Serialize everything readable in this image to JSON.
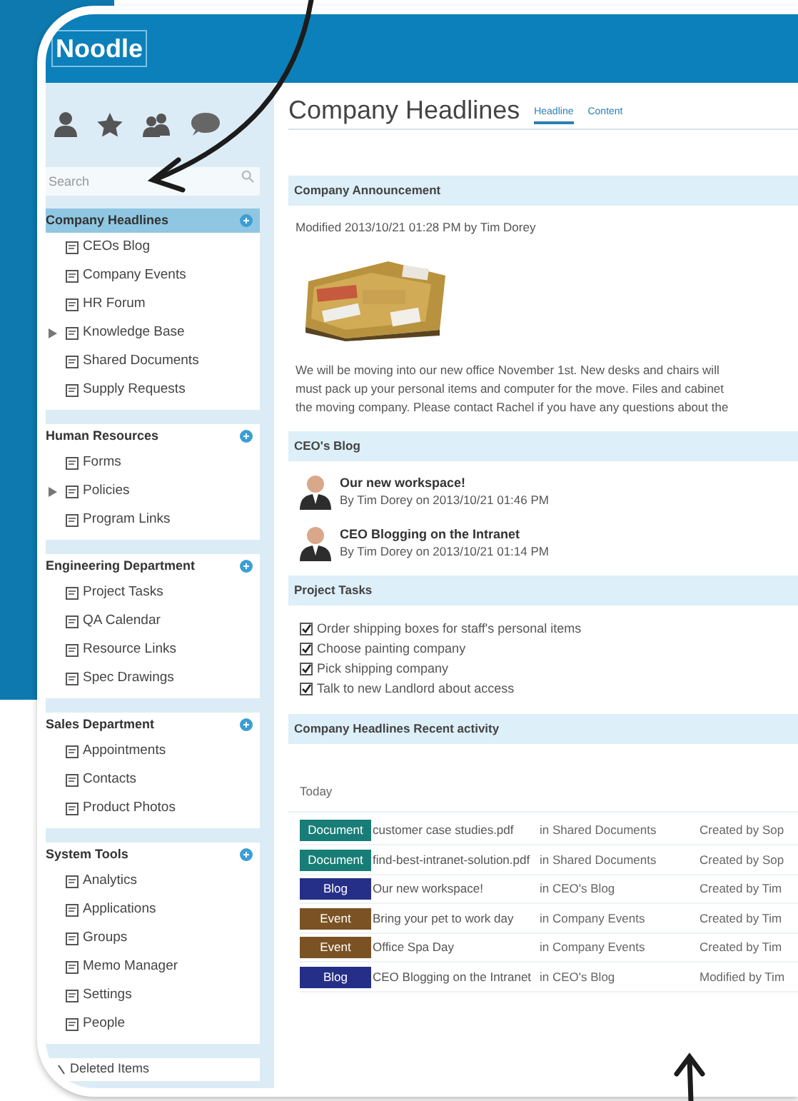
{
  "header": {
    "logo": "Noodle"
  },
  "sidebar": {
    "search": {
      "placeholder": "Search"
    },
    "sections": [
      {
        "title": "Company Headlines",
        "selected": true,
        "items": [
          {
            "label": "CEOs Blog",
            "expandable": false
          },
          {
            "label": "Company Events",
            "expandable": false
          },
          {
            "label": "HR Forum",
            "expandable": false
          },
          {
            "label": "Knowledge Base",
            "expandable": true
          },
          {
            "label": "Shared Documents",
            "expandable": false
          },
          {
            "label": "Supply Requests",
            "expandable": false
          }
        ]
      },
      {
        "title": "Human Resources",
        "selected": false,
        "items": [
          {
            "label": "Forms",
            "expandable": false
          },
          {
            "label": "Policies",
            "expandable": true
          },
          {
            "label": "Program Links",
            "expandable": false
          }
        ]
      },
      {
        "title": "Engineering Department",
        "selected": false,
        "items": [
          {
            "label": "Project Tasks",
            "expandable": false
          },
          {
            "label": "QA Calendar",
            "expandable": false
          },
          {
            "label": "Resource Links",
            "expandable": false
          },
          {
            "label": "Spec Drawings",
            "expandable": false
          }
        ]
      },
      {
        "title": "Sales Department",
        "selected": false,
        "items": [
          {
            "label": "Appointments",
            "expandable": false
          },
          {
            "label": "Contacts",
            "expandable": false
          },
          {
            "label": "Product Photos",
            "expandable": false
          }
        ]
      },
      {
        "title": "System Tools",
        "selected": false,
        "items": [
          {
            "label": "Analytics",
            "expandable": false
          },
          {
            "label": "Applications",
            "expandable": false
          },
          {
            "label": "Groups",
            "expandable": false
          },
          {
            "label": "Memo Manager",
            "expandable": false
          },
          {
            "label": "Settings",
            "expandable": false
          },
          {
            "label": "People",
            "expandable": false
          }
        ]
      }
    ],
    "footer_item": "Deleted Items"
  },
  "page": {
    "title": "Company Headlines",
    "tabs": [
      {
        "label": "Headline",
        "selected": true
      },
      {
        "label": "Content",
        "selected": false
      }
    ]
  },
  "announcement": {
    "heading": "Company Announcement",
    "meta": "Modified 2013/10/21 01:28 PM by Tim Dorey",
    "lines": [
      "We will be moving into our new office November 1st.  New desks and chairs will",
      "must pack up your personal items and computer for the move.  Files and cabinet",
      "the moving company.  Please contact Rachel if you have any questions about the"
    ]
  },
  "blog": {
    "heading": "CEO's Blog",
    "posts": [
      {
        "title": "Our new workspace!",
        "byline": "By  Tim Dorey on 2013/10/21 01:46 PM"
      },
      {
        "title": "CEO Blogging on the Intranet",
        "byline": "By  Tim Dorey on 2013/10/21 01:14 PM"
      }
    ]
  },
  "tasks": {
    "heading": "Project Tasks",
    "items": [
      {
        "label": "Order shipping boxes for staff's personal items",
        "checked": true
      },
      {
        "label": "Choose painting company",
        "checked": true
      },
      {
        "label": "Pick shipping company",
        "checked": true
      },
      {
        "label": "Talk to new Landlord about access",
        "checked": true
      }
    ]
  },
  "activity": {
    "heading": "Company Headlines Recent activity",
    "group": "Today",
    "rows": [
      {
        "type": "Document",
        "color": "#177d76",
        "title": "customer case studies.pdf",
        "location": "in Shared Documents",
        "by": "Created by Sop"
      },
      {
        "type": "Document",
        "color": "#177d76",
        "title": "find-best-intranet-solution.pdf",
        "location": "in Shared Documents",
        "by": "Created by Sop"
      },
      {
        "type": "Blog",
        "color": "#262f88",
        "title": "Our new workspace!",
        "location": "in CEO's Blog",
        "by": "Created by Tim"
      },
      {
        "type": "Event",
        "color": "#7b5224",
        "title": "Bring your pet to work day",
        "location": "in Company Events",
        "by": "Created by Tim"
      },
      {
        "type": "Event",
        "color": "#7b5224",
        "title": "Office Spa Day",
        "location": "in Company Events",
        "by": "Created by Tim"
      },
      {
        "type": "Blog",
        "color": "#262f88",
        "title": "CEO Blogging on the Intranet",
        "location": "in CEO's Blog",
        "by": "Modified by Tim"
      }
    ]
  }
}
